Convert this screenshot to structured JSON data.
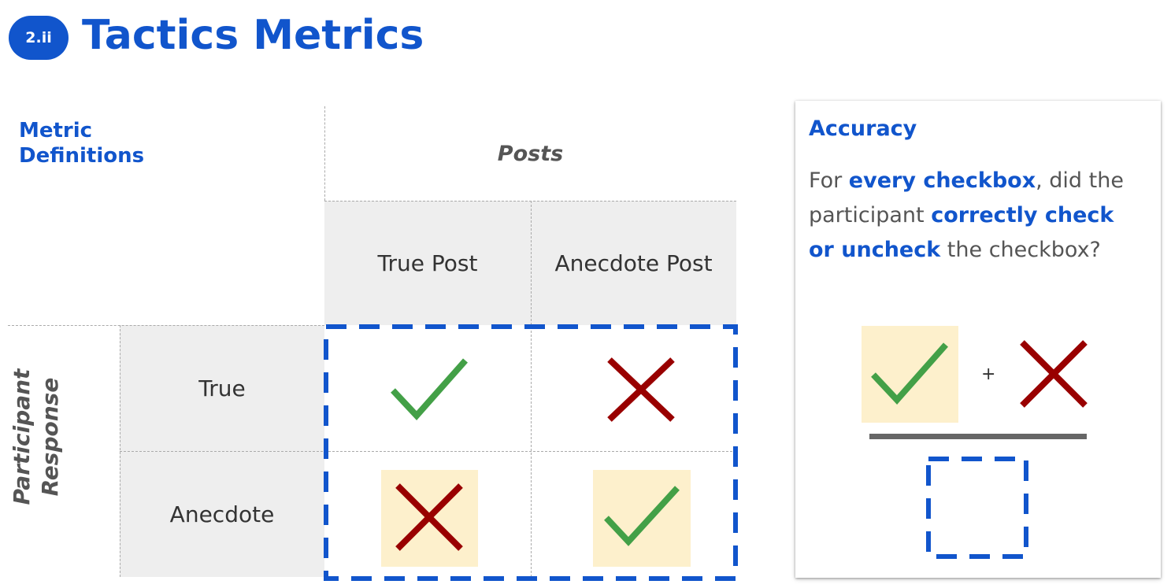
{
  "header": {
    "badge": "2.ii",
    "title": "Tactics Metrics"
  },
  "matrix": {
    "section_label": "Metric Definitions",
    "column_group_label": "Posts",
    "row_group_label": "Participant Response",
    "columns": [
      "True Post",
      "Anecdote Post"
    ],
    "rows": [
      "True",
      "Anecdote"
    ],
    "cells": [
      [
        {
          "mark": "check",
          "color": "#43a047",
          "highlighted": false
        },
        {
          "mark": "cross",
          "color": "#990000",
          "highlighted": false
        }
      ],
      [
        {
          "mark": "cross",
          "color": "#990000",
          "highlighted": true
        },
        {
          "mark": "check",
          "color": "#43a047",
          "highlighted": true
        }
      ]
    ]
  },
  "accuracy": {
    "title": "Accuracy",
    "desc_part1": "For ",
    "desc_bold1": "every checkbox",
    "desc_part2": ", did the participant ",
    "desc_bold2": "correctly check or uncheck",
    "desc_part3": " the checkbox?",
    "plus": "+"
  },
  "colors": {
    "accent": "#1155cc",
    "highlight": "#fdf0cc",
    "header_bg": "#eeeeee",
    "check": "#43a047",
    "cross": "#990000"
  }
}
